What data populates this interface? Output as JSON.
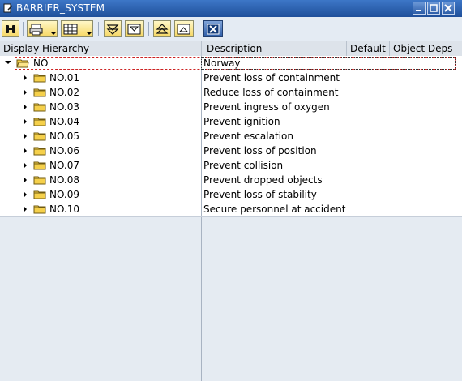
{
  "window": {
    "title": "BARRIER_SYSTEM"
  },
  "icons": {
    "title": "display-edit-icon",
    "find": "binoculars-icon",
    "print": "printer-icon",
    "layout": "table-layout-icon",
    "expand": "expand-subtree-icon",
    "expand_all": "expand-all-icon",
    "collapse": "collapse-subtree-icon",
    "collapse_all": "collapse-all-icon",
    "cancel": "cancel-icon"
  },
  "columns": {
    "hierarchy": "Display Hierarchy",
    "description": "Description",
    "default": "Default",
    "object_deps": "Object Deps"
  },
  "root": {
    "node": "NO",
    "description": "Norway"
  },
  "rows": [
    {
      "node": "NO.01",
      "description": "Prevent loss of containment"
    },
    {
      "node": "NO.02",
      "description": "Reduce loss of containment"
    },
    {
      "node": "NO.03",
      "description": "Prevent ingress of oxygen"
    },
    {
      "node": "NO.04",
      "description": "Prevent ignition"
    },
    {
      "node": "NO.05",
      "description": "Prevent escalation"
    },
    {
      "node": "NO.06",
      "description": "Prevent loss of position"
    },
    {
      "node": "NO.07",
      "description": "Prevent collision"
    },
    {
      "node": "NO.08",
      "description": "Prevent dropped objects"
    },
    {
      "node": "NO.09",
      "description": "Prevent loss of stability"
    },
    {
      "node": "NO.10",
      "description": "Secure personnel at accident"
    }
  ],
  "colors": {
    "folder": "#f5d04b",
    "title_bar": "#2a5ca8",
    "selection": "#cc2222"
  }
}
